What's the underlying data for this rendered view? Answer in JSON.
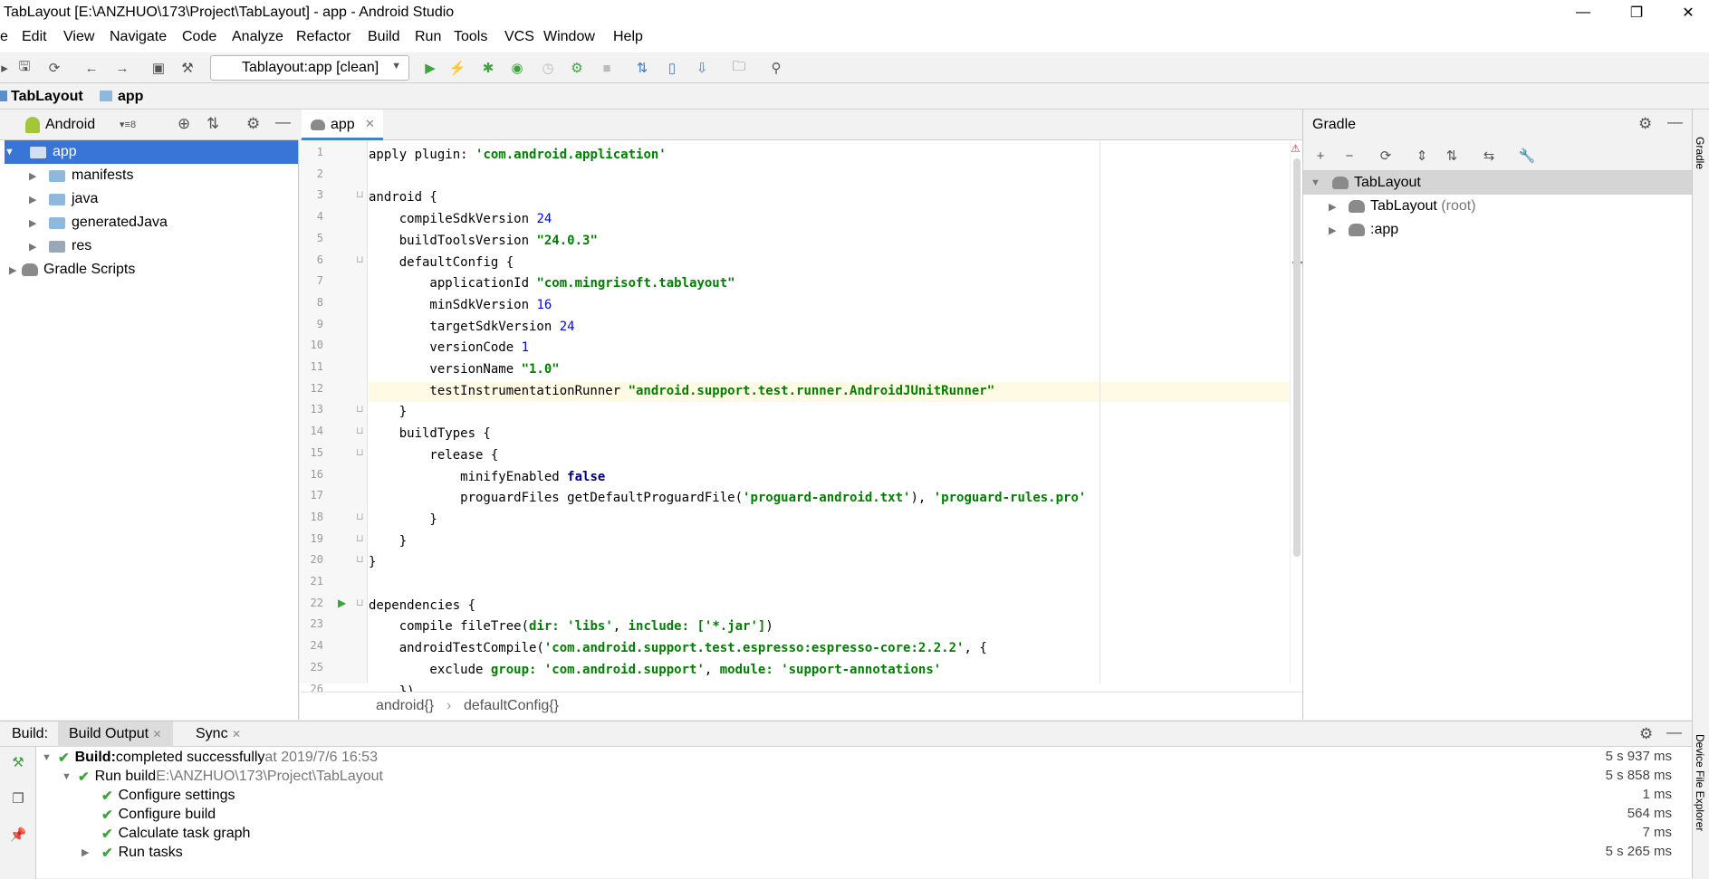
{
  "window": {
    "title": "TabLayout [E:\\ANZHUO\\173\\Project\\TabLayout] - app - Android Studio",
    "minimize_icon": "minimize-icon",
    "maximize_icon": "maximize-icon",
    "close_icon": "close-icon"
  },
  "menu": [
    "e",
    "Edit",
    "View",
    "Navigate",
    "Code",
    "Analyze",
    "Refactor",
    "Build",
    "Run",
    "Tools",
    "VCS",
    "Window",
    "Help"
  ],
  "toolbar": {
    "run_config": "Tablayout:app [clean]"
  },
  "breadcrumb": {
    "project": "TabLayout",
    "module": "app"
  },
  "project_panel": {
    "view": "Android",
    "count": "8",
    "tree": [
      {
        "label": "app",
        "selected": true
      },
      {
        "label": "manifests"
      },
      {
        "label": "java"
      },
      {
        "label": "generatedJava"
      },
      {
        "label": "res"
      },
      {
        "label": "Gradle Scripts"
      }
    ]
  },
  "editor": {
    "tab": "app",
    "lines": [
      "1",
      "2",
      "3",
      "4",
      "5",
      "6",
      "7",
      "8",
      "9",
      "10",
      "11",
      "12",
      "13",
      "14",
      "15",
      "16",
      "17",
      "18",
      "19",
      "20",
      "21",
      "22",
      "23",
      "24",
      "25",
      "26"
    ],
    "code": [
      {
        "t": "apply plugin: ",
        "s": "'com.android.application'"
      },
      {
        "t": ""
      },
      {
        "t": "android {"
      },
      {
        "t": "    compileSdkVersion ",
        "n": "24"
      },
      {
        "t": "    buildToolsVersion ",
        "s": "\"24.0.3\""
      },
      {
        "t": "    defaultConfig {"
      },
      {
        "t": "        applicationId ",
        "s": "\"com.mingrisoft.tablayout\""
      },
      {
        "t": "        minSdkVersion ",
        "n": "16"
      },
      {
        "t": "        targetSdkVersion ",
        "n": "24"
      },
      {
        "t": "        versionCode ",
        "n": "1"
      },
      {
        "t": "        versionName ",
        "s": "\"1.0\""
      },
      {
        "t": "        testInstrumentationRunner ",
        "s": "\"android.support.test.runner.AndroidJUnitRunner\""
      },
      {
        "t": "    }"
      },
      {
        "t": "    buildTypes {"
      },
      {
        "t": "        release {"
      },
      {
        "t": "            minifyEnabled ",
        "k": "false"
      },
      {
        "t": "            proguardFiles getDefaultProguardFile(",
        "s": "'proguard-android.txt'",
        "t2": "), ",
        "s2": "'proguard-rules.pro'"
      },
      {
        "t": "        }"
      },
      {
        "t": "    }"
      },
      {
        "t": "}"
      },
      {
        "t": ""
      },
      {
        "t": "dependencies {"
      },
      {
        "t": "    compile fileTree(",
        "s": "dir: ",
        "t2": "",
        "s2": "'libs'",
        "t3": ", ",
        "s3": "include: ",
        "t4": "",
        "s4": "['*.jar']",
        "t5": ")"
      },
      {
        "t": "    androidTestCompile(",
        "s": "'com.android.support.test.espresso:espresso-core:2.2.2'",
        "t2": ", {"
      },
      {
        "t": "        exclude ",
        "s": "group: ",
        "t2": "",
        "s2": "'com.android.support'",
        "t3": ", ",
        "s3": "module: ",
        "t4": "",
        "s4": "'support-annotations'"
      },
      {
        "t": "    })"
      }
    ],
    "breadcrumb": [
      "android{}",
      "defaultConfig{}"
    ]
  },
  "gradle_panel": {
    "title": "Gradle",
    "tree": [
      {
        "label": "TabLayout"
      },
      {
        "label": "TabLayout",
        "suffix": "(root)"
      },
      {
        "label": ":app"
      }
    ],
    "side_label": "Gradle"
  },
  "build_panel": {
    "label": "Build:",
    "tabs": [
      "Build Output",
      "Sync"
    ],
    "rows": [
      {
        "bold": "Build:",
        "text": " completed successfully",
        "muted": " at 2019/7/6 16:53",
        "dur": "5 s 937 ms"
      },
      {
        "text": "Run build",
        "muted": " E:\\ANZHUO\\173\\Project\\TabLayout",
        "dur": "5 s 858 ms"
      },
      {
        "text": "Configure settings",
        "dur": "1 ms"
      },
      {
        "text": "Configure build",
        "dur": "564 ms"
      },
      {
        "text": "Calculate task graph",
        "dur": "7 ms"
      },
      {
        "text": "Run tasks",
        "dur": "5 s 265 ms"
      }
    ],
    "side_label": "Device File Explorer"
  },
  "colors": {
    "selection": "#4083c9",
    "string": "#008000",
    "number": "#0000ff",
    "keyword": "#000080",
    "success": "#3aa53a"
  }
}
